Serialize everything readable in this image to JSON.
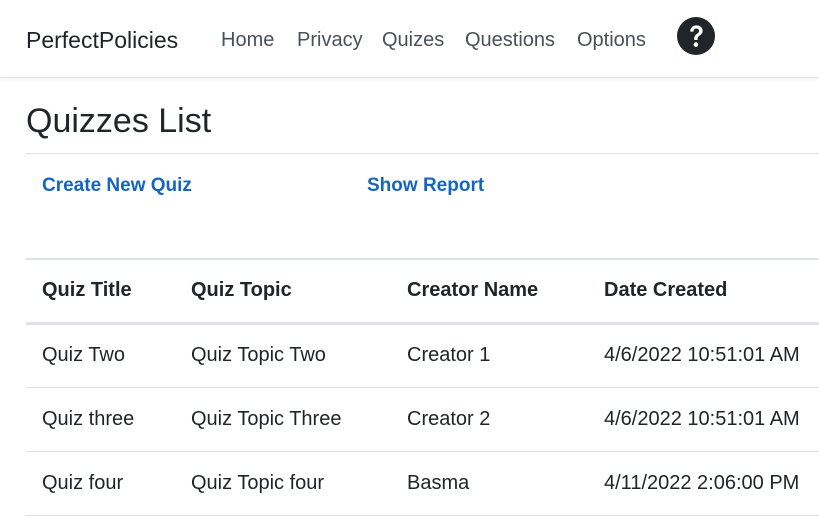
{
  "nav": {
    "brand": "PerfectPolicies",
    "links": [
      "Home",
      "Privacy",
      "Quizes",
      "Questions",
      "Options"
    ],
    "help_icon": "question-circle-icon"
  },
  "page": {
    "title": "Quizzes List",
    "actions": {
      "create": "Create New Quiz",
      "report": "Show Report"
    }
  },
  "table": {
    "headers": [
      "Quiz Title",
      "Quiz Topic",
      "Creator Name",
      "Date Created"
    ],
    "rows": [
      [
        "Quiz Two",
        "Quiz Topic Two",
        "Creator 1",
        "4/6/2022 10:51:01 AM"
      ],
      [
        "Quiz three",
        "Quiz Topic Three",
        "Creator 2",
        "4/6/2022 10:51:01 AM"
      ],
      [
        "Quiz four",
        "Quiz Topic four",
        "Basma",
        "4/11/2022 2:06:00 PM"
      ]
    ]
  },
  "colors": {
    "link": "#1565c0",
    "text": "#212529",
    "nav_text": "#495057",
    "border": "#dee2e6"
  }
}
